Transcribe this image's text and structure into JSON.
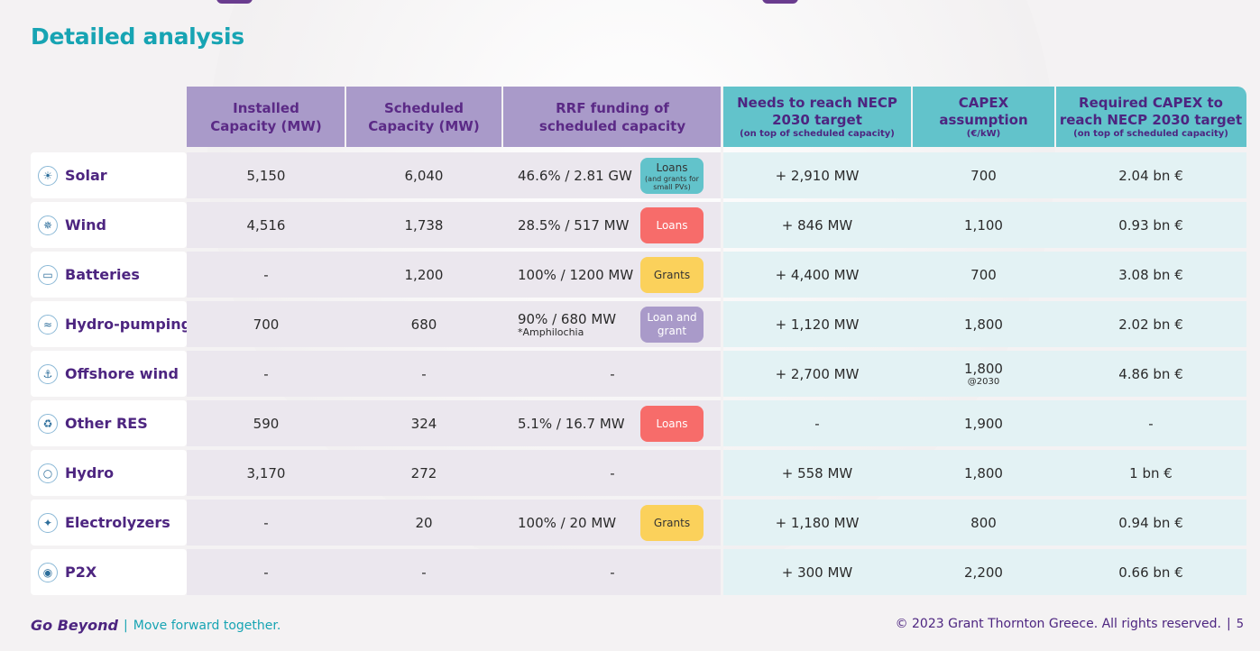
{
  "title": "Detailed analysis",
  "columns": [
    {
      "label": "Installed Capacity (MW)",
      "sub": ""
    },
    {
      "label": "Scheduled Capacity (MW)",
      "sub": ""
    },
    {
      "label": "RRF funding of scheduled capacity",
      "sub": ""
    },
    {
      "label": "Needs to reach NECP 2030 target",
      "sub": "(on top of scheduled capacity)"
    },
    {
      "label": "CAPEX assumption",
      "sub": "(€/kW)"
    },
    {
      "label": "Required CAPEX to reach NECP 2030 target",
      "sub": "(on top of scheduled capacity)"
    }
  ],
  "rows": [
    {
      "label": "Solar",
      "icon": "sun-icon",
      "installed": "5,150",
      "scheduled": "6,040",
      "rrf": "46.6% / 2.81 GW",
      "rrf_note": "",
      "badge": "Loans",
      "badge_note": "(and grants for small PVs)",
      "badge_type": "teal",
      "needs": "+ 2,910 MW",
      "capex": "700",
      "capex_note": "",
      "required": "2.04 bn €"
    },
    {
      "label": "Wind",
      "icon": "wind-turbine-icon",
      "installed": "4,516",
      "scheduled": "1,738",
      "rrf": "28.5% / 517 MW",
      "rrf_note": "",
      "badge": "Loans",
      "badge_note": "",
      "badge_type": "loans",
      "needs": "+ 846 MW",
      "capex": "1,100",
      "capex_note": "",
      "required": "0.93 bn €"
    },
    {
      "label": "Batteries",
      "icon": "battery-icon",
      "installed": "-",
      "scheduled": "1,200",
      "rrf": "100% / 1200 MW",
      "rrf_note": "",
      "badge": "Grants",
      "badge_note": "",
      "badge_type": "grants",
      "needs": "+ 4,400 MW",
      "capex": "700",
      "capex_note": "",
      "required": "3.08 bn €"
    },
    {
      "label": "Hydro-pumping",
      "icon": "hydro-pump-icon",
      "installed": "700",
      "scheduled": "680",
      "rrf": "90% / 680 MW",
      "rrf_note": "*Amphilochia",
      "badge": "Loan and grant",
      "badge_note": "",
      "badge_type": "mixed",
      "needs": "+ 1,120 MW",
      "capex": "1,800",
      "capex_note": "",
      "required": "2.02 bn €"
    },
    {
      "label": "Offshore wind",
      "icon": "offshore-wind-icon",
      "installed": "-",
      "scheduled": "-",
      "rrf": "-",
      "rrf_note": "",
      "badge": "",
      "badge_note": "",
      "badge_type": "",
      "needs": "+ 2,700 MW",
      "capex": "1,800",
      "capex_note": "@2030",
      "required": "4.86 bn €"
    },
    {
      "label": "Other RES",
      "icon": "recycle-icon",
      "installed": "590",
      "scheduled": "324",
      "rrf": "5.1% / 16.7 MW",
      "rrf_note": "",
      "badge": "Loans",
      "badge_note": "",
      "badge_type": "loans",
      "needs": "-",
      "capex": "1,900",
      "capex_note": "",
      "required": "-"
    },
    {
      "label": "Hydro",
      "icon": "water-drop-icon",
      "installed": "3,170",
      "scheduled": "272",
      "rrf": "-",
      "rrf_note": "",
      "badge": "",
      "badge_note": "",
      "badge_type": "",
      "needs": "+ 558 MW",
      "capex": "1,800",
      "capex_note": "",
      "required": "1 bn €"
    },
    {
      "label": "Electrolyzers",
      "icon": "molecule-icon",
      "installed": "-",
      "scheduled": "20",
      "rrf": "100% / 20 MW",
      "rrf_note": "",
      "badge": "Grants",
      "badge_note": "",
      "badge_type": "grants",
      "needs": "+ 1,180 MW",
      "capex": "800",
      "capex_note": "",
      "required": "0.94 bn €"
    },
    {
      "label": "P2X",
      "icon": "bulb-icon",
      "installed": "-",
      "scheduled": "-",
      "rrf": "-",
      "rrf_note": "",
      "badge": "",
      "badge_note": "",
      "badge_type": "",
      "needs": "+ 300 MW",
      "capex": "2,200",
      "capex_note": "",
      "required": "0.66 bn €"
    }
  ],
  "footer": {
    "brand": "Go Beyond",
    "tagline": "Move forward together.",
    "copyright": "© 2023 Grant Thornton Greece. All rights reserved.",
    "page": "5"
  }
}
